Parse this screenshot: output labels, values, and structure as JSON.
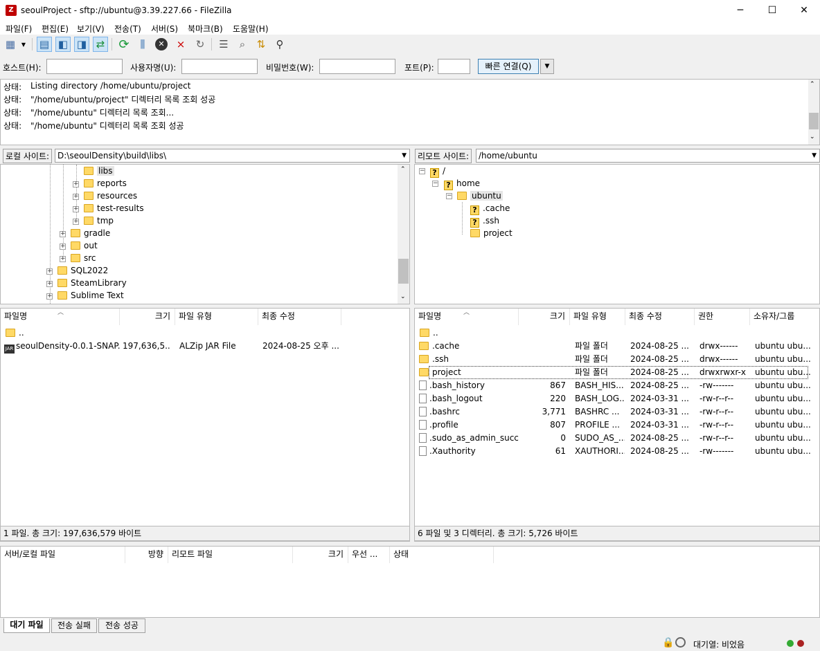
{
  "window": {
    "title": "seoulProject - sftp://ubuntu@3.39.227.66 - FileZilla",
    "app_icon": "Z"
  },
  "menu": [
    "파일(F)",
    "편집(E)",
    "보기(V)",
    "전송(T)",
    "서버(S)",
    "북마크(B)",
    "도움말(H)"
  ],
  "quickconnect": {
    "host_label": "호스트(H):",
    "user_label": "사용자명(U):",
    "pass_label": "비밀번호(W):",
    "port_label": "포트(P):",
    "button": "빠른 연결(Q)"
  },
  "log": [
    {
      "label": "상태:",
      "text": "Listing directory /home/ubuntu/project"
    },
    {
      "label": "상태:",
      "text": "\"/home/ubuntu/project\" 디렉터리 목록 조회 성공"
    },
    {
      "label": "상태:",
      "text": "\"/home/ubuntu\" 디렉터리 목록 조회..."
    },
    {
      "label": "상태:",
      "text": "\"/home/ubuntu\" 디렉터리 목록 조회 성공"
    }
  ],
  "local": {
    "site_label": "로컬 사이트:",
    "path": "D:\\seoulDensity\\build\\libs\\",
    "tree": [
      "libs",
      "reports",
      "resources",
      "test-results",
      "tmp",
      "gradle",
      "out",
      "src",
      "SQL2022",
      "SteamLibrary",
      "Sublime Text"
    ],
    "headers": {
      "name": "파일명",
      "size": "크기",
      "type": "파일 유형",
      "modified": "최종 수정"
    },
    "parent": "..",
    "files": [
      {
        "name": "seoulDensity-0.0.1-SNAP...",
        "size": "197,636,5...",
        "type": "ALZip JAR File",
        "modified": "2024-08-25 오후 ..."
      }
    ],
    "status": "1 파일. 총 크기: 197,636,579 바이트"
  },
  "remote": {
    "site_label": "리모트 사이트:",
    "path": "/home/ubuntu",
    "tree": [
      "/",
      "home",
      "ubuntu",
      ".cache",
      ".ssh",
      "project"
    ],
    "headers": {
      "name": "파일명",
      "size": "크기",
      "type": "파일 유형",
      "modified": "최종 수정",
      "perm": "권한",
      "owner": "소유자/그룹"
    },
    "parent": "..",
    "files": [
      {
        "name": ".cache",
        "size": "",
        "type": "파일 폴더",
        "modified": "2024-08-25 ...",
        "perm": "drwx------",
        "owner": "ubuntu ubu...",
        "folder": true
      },
      {
        "name": ".ssh",
        "size": "",
        "type": "파일 폴더",
        "modified": "2024-08-25 ...",
        "perm": "drwx------",
        "owner": "ubuntu ubu...",
        "folder": true
      },
      {
        "name": "project",
        "size": "",
        "type": "파일 폴더",
        "modified": "2024-08-25 ...",
        "perm": "drwxrwxr-x",
        "owner": "ubuntu ubu...",
        "folder": true
      },
      {
        "name": ".bash_history",
        "size": "867",
        "type": "BASH_HIS...",
        "modified": "2024-08-25 ...",
        "perm": "-rw-------",
        "owner": "ubuntu ubu...",
        "folder": false
      },
      {
        "name": ".bash_logout",
        "size": "220",
        "type": "BASH_LOG...",
        "modified": "2024-03-31 ...",
        "perm": "-rw-r--r--",
        "owner": "ubuntu ubu...",
        "folder": false
      },
      {
        "name": ".bashrc",
        "size": "3,771",
        "type": "BASHRC ...",
        "modified": "2024-03-31 ...",
        "perm": "-rw-r--r--",
        "owner": "ubuntu ubu...",
        "folder": false
      },
      {
        "name": ".profile",
        "size": "807",
        "type": "PROFILE ...",
        "modified": "2024-03-31 ...",
        "perm": "-rw-r--r--",
        "owner": "ubuntu ubu...",
        "folder": false
      },
      {
        "name": ".sudo_as_admin_succ...",
        "size": "0",
        "type": "SUDO_AS_...",
        "modified": "2024-08-25 ...",
        "perm": "-rw-r--r--",
        "owner": "ubuntu ubu...",
        "folder": false
      },
      {
        "name": ".Xauthority",
        "size": "61",
        "type": "XAUTHORI...",
        "modified": "2024-08-25 ...",
        "perm": "-rw-------",
        "owner": "ubuntu ubu...",
        "folder": false
      }
    ],
    "status": "6 파일 및 3 디렉터리. 총 크기: 5,726 바이트"
  },
  "queue": {
    "headers": [
      "서버/로컬 파일",
      "방향",
      "리모트 파일",
      "크기",
      "우선 ...",
      "상태"
    ],
    "tabs": [
      "대기 파일",
      "전송 실패",
      "전송 성공"
    ]
  },
  "statusbar": {
    "queue": "대기열: 비었음"
  }
}
